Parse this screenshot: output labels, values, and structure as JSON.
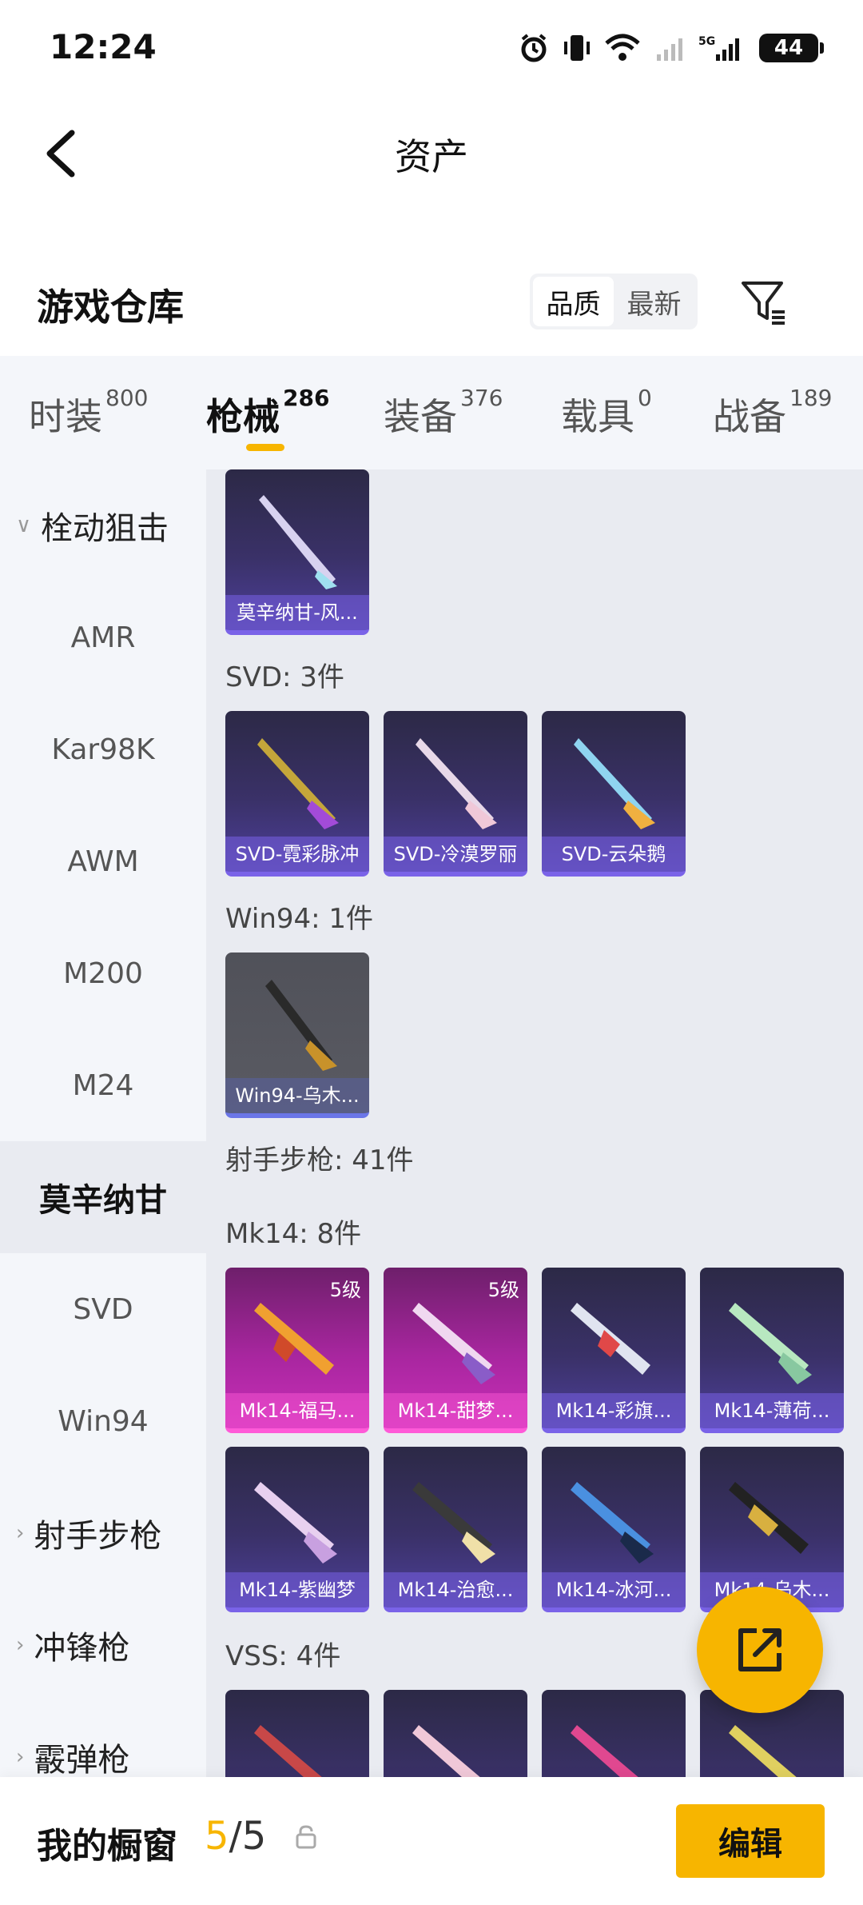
{
  "status_bar": {
    "time": "12:24",
    "battery": "44",
    "network": "5G"
  },
  "nav": {
    "title": "资产"
  },
  "warehouse": {
    "title": "游戏仓库",
    "sort_options": [
      "品质",
      "最新"
    ],
    "active_sort": "品质"
  },
  "tabs": [
    {
      "label": "时装",
      "count": "800"
    },
    {
      "label": "枪械",
      "count": "286"
    },
    {
      "label": "装备",
      "count": "376"
    },
    {
      "label": "载具",
      "count": "0"
    },
    {
      "label": "战备",
      "count": "189"
    }
  ],
  "sidebar": {
    "items": [
      {
        "label": "栓动狙击",
        "type": "group",
        "expanded": true
      },
      {
        "label": "AMR"
      },
      {
        "label": "Kar98K"
      },
      {
        "label": "AWM"
      },
      {
        "label": "M200"
      },
      {
        "label": "M24"
      },
      {
        "label": "莫辛纳甘",
        "selected": true
      },
      {
        "label": "SVD"
      },
      {
        "label": "Win94"
      },
      {
        "label": "射手步枪",
        "type": "group"
      },
      {
        "label": "冲锋枪",
        "type": "group"
      },
      {
        "label": "霰弹枪",
        "type": "group"
      }
    ]
  },
  "content": {
    "sections": [
      {
        "label": "",
        "cards": [
          {
            "name": "莫辛纳甘-风...",
            "style": "purple"
          }
        ]
      },
      {
        "label": "SVD: 3件",
        "cards": [
          {
            "name": "SVD-霓彩脉冲",
            "style": "purple"
          },
          {
            "name": "SVD-冷漠罗丽",
            "style": "purple"
          },
          {
            "name": "SVD-云朵鹅",
            "style": "purple"
          }
        ]
      },
      {
        "label": "Win94: 1件",
        "cards": [
          {
            "name": "Win94-乌木...",
            "style": "gray"
          }
        ]
      },
      {
        "label": "射手步枪: 41件",
        "cards": []
      },
      {
        "label": "Mk14: 8件",
        "cards": [
          {
            "name": "Mk14-福马...",
            "style": "pink",
            "level": "5级"
          },
          {
            "name": "Mk14-甜梦...",
            "style": "pink",
            "level": "5级"
          },
          {
            "name": "Mk14-彩旗...",
            "style": "purple"
          },
          {
            "name": "Mk14-薄荷...",
            "style": "purple"
          },
          {
            "name": "Mk14-紫幽梦",
            "style": "purple"
          },
          {
            "name": "Mk14-治愈...",
            "style": "purple"
          },
          {
            "name": "Mk14-冰河...",
            "style": "purple"
          },
          {
            "name": "Mk14-乌木...",
            "style": "purple"
          }
        ]
      },
      {
        "label": "VSS: 4件",
        "cards": []
      }
    ]
  },
  "bottom_bar": {
    "title": "我的橱窗",
    "current": "5",
    "separator": "/",
    "max": "5",
    "edit_label": "编辑"
  },
  "colors": {
    "accent": "#f7b500",
    "card_purple": "#3a3168",
    "card_pink": "#a8269f",
    "card_gray": "#5a5b63"
  },
  "icons": [
    "back-arrow-icon",
    "filter-icon",
    "share-icon",
    "lock-icon",
    "alarm-icon",
    "vibrate-icon",
    "wifi-icon",
    "signal-icon",
    "battery-icon"
  ]
}
